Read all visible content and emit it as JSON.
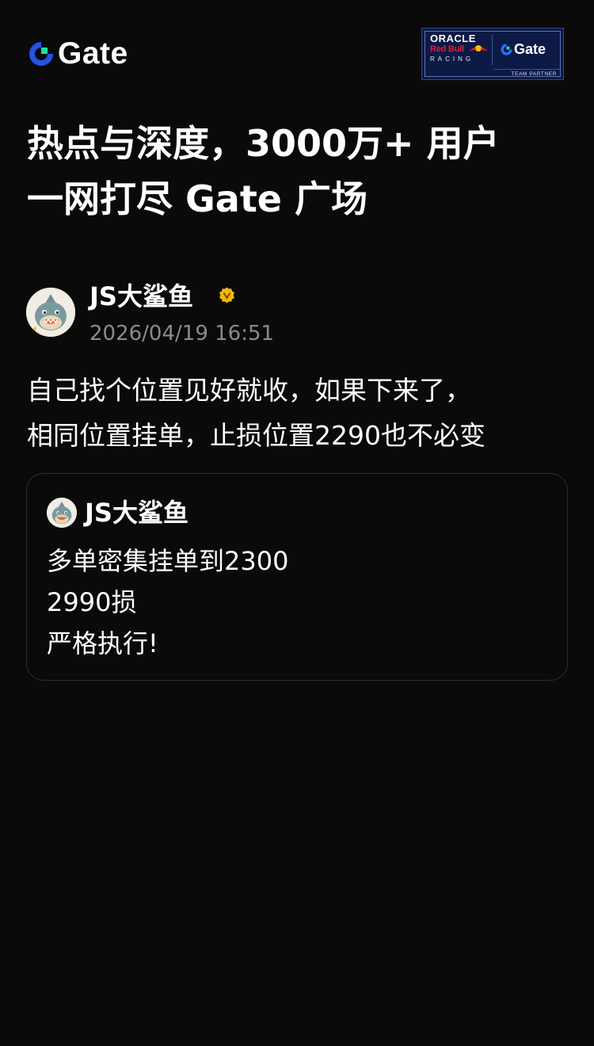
{
  "header": {
    "brand_name": "Gate",
    "partner_badge": {
      "line1": "ORACLE",
      "line2": "Red Bull",
      "line3": "RACING",
      "brand": "Gate",
      "tagline": "TEAM PARTNER"
    }
  },
  "headline": {
    "line1": "热点与深度，3000万+ 用户",
    "line2": "一网打尽 Gate 广场"
  },
  "post": {
    "author_name": "JS大鲨鱼",
    "timestamp": "2026/04/19 16:51",
    "body_lines": [
      "自己找个位置见好就收，如果下来了，",
      "相同位置挂单，止损位置2290也不必变"
    ]
  },
  "quoted_post": {
    "author_name": "JS大鲨鱼",
    "body_lines": [
      "多单密集挂单到2300",
      "2990损",
      "严格执行!"
    ]
  },
  "colors": {
    "background": "#0a0a0a",
    "text_primary": "#ffffff",
    "text_secondary": "#8b8b8b",
    "brand_blue": "#2354e6",
    "brand_green": "#17e6a1",
    "verified_gold": "#f0b90b",
    "card_border": "#2e2e2e"
  },
  "icons": {
    "brand_logo": "gate-logo-icon",
    "verified_badge": "verified-badge-icon",
    "avatar": "shark-avatar"
  }
}
